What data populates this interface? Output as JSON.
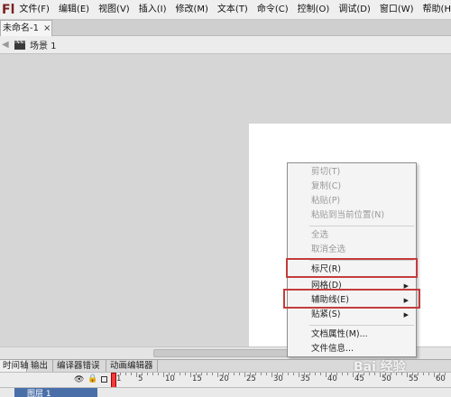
{
  "app": {
    "logo_text": "Fl"
  },
  "menubar": {
    "items": [
      "文件(F)",
      "编辑(E)",
      "视图(V)",
      "插入(I)",
      "修改(M)",
      "文本(T)",
      "命令(C)",
      "控制(O)",
      "调试(D)",
      "窗口(W)",
      "帮助(H)"
    ]
  },
  "document_tab": {
    "title": "未命名-1",
    "close": "×"
  },
  "editbar": {
    "scene": "场景 1"
  },
  "context_menu": {
    "items": [
      {
        "label": "剪切(T)",
        "enabled": false
      },
      {
        "label": "复制(C)",
        "enabled": false
      },
      {
        "label": "粘贴(P)",
        "enabled": false
      },
      {
        "label": "粘贴到当前位置(N)",
        "enabled": false
      },
      {
        "label": "全选",
        "enabled": false
      },
      {
        "label": "取消全选",
        "enabled": false
      },
      {
        "label": "标尺(R)",
        "enabled": true
      },
      {
        "label": "网格(D)",
        "enabled": true,
        "submenu": true
      },
      {
        "label": "辅助线(E)",
        "enabled": true,
        "submenu": true
      },
      {
        "label": "贴紧(S)",
        "enabled": true,
        "submenu": true
      },
      {
        "label": "文档属性(M)...",
        "enabled": true
      },
      {
        "label": "文件信息...",
        "enabled": true
      }
    ],
    "highlight_color": "#c43c3c"
  },
  "panel_tabs": [
    "时间轴",
    "输出",
    "编译器错误",
    "动画编辑器"
  ],
  "timeline": {
    "frame_labels": [
      "1",
      "5",
      "10",
      "15",
      "20",
      "25",
      "30",
      "35",
      "40",
      "45",
      "50",
      "55",
      "60"
    ],
    "layer_name": "图层 1"
  },
  "watermark": "Bai 经验"
}
